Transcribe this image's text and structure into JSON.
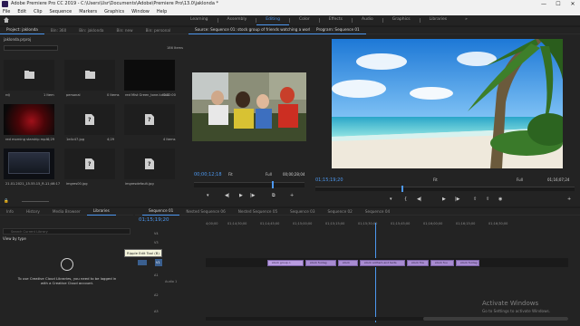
{
  "titlebar": {
    "title": "Adobe Premiere Pro CC 2019 - C:\\Users\\Usr\\Documents\\Adobe\\Premiere Pro\\13.0\\jaklonda *",
    "minimize": "—",
    "maximize": "☐",
    "close": "✕"
  },
  "menu": [
    "File",
    "Edit",
    "Clip",
    "Sequence",
    "Markers",
    "Graphics",
    "Window",
    "Help"
  ],
  "workspaces": {
    "tabs": [
      "Learning",
      "Assembly",
      "Editing",
      "Color",
      "Effects",
      "Audio",
      "Graphics",
      "Libraries"
    ],
    "active": "Editing",
    "more": "»"
  },
  "project": {
    "tabs": [
      "Project: jaklonda",
      "Bin: 360",
      "Bin: jaklonda",
      "Bin: new",
      "Bin: personal"
    ],
    "file": "jaklonda.prproj",
    "item_count": "186 Items",
    "items": [
      {
        "label": "rdj",
        "meta": "1 Item",
        "kind": "folder"
      },
      {
        "label": "personal",
        "meta": "",
        "kind": "folder"
      },
      {
        "label": "",
        "meta": "0 Items",
        "kind": "folder"
      },
      {
        "label": "red Mist Green_tone.lutOct",
        "meta": "1:22:00",
        "kind": "thumb-dark"
      },
      {
        "label": "red morning starship mp4",
        "meta": "4;29",
        "kind": "thumb-red"
      },
      {
        "label": "1e4c47.jpg",
        "meta": "4;29",
        "kind": "file"
      },
      {
        "label": "",
        "meta": "",
        "kind": "file"
      },
      {
        "label": "",
        "meta": "4 Items",
        "kind": "file"
      },
      {
        "label": "21.01.2021_15.55.15_R...",
        "meta": "11;46:17",
        "kind": "thumb-screen"
      },
      {
        "label": "imgres00.jpg",
        "meta": "4;29",
        "kind": "file"
      },
      {
        "label": "imgresdefault (1).jpg",
        "meta": "4;29",
        "kind": "file"
      },
      {
        "label": "imgresdefault.jpg",
        "meta": "4;29",
        "kind": "file"
      }
    ]
  },
  "source": {
    "tab": "Source: Sequence 01: stock group of friends watching a world cup m",
    "timecode": "00;00;12;18",
    "fit": "Fit",
    "quality": "Full",
    "duration": "00;00;28;04"
  },
  "program": {
    "tab": "Program: Sequence 01",
    "timecode": "01;15;19;20",
    "fit": "Fit",
    "quality": "Full",
    "duration": "01;16;07;24"
  },
  "libraries": {
    "tabs": [
      "Info",
      "History",
      "Media Browser",
      "Libraries"
    ],
    "view_by": "View by type",
    "search_placeholder": "Search Current Library",
    "message": "To use Creative Cloud Libraries, you need to be logged in with a Creative Cloud account."
  },
  "tooltip": "Ripple Edit Tool (B)",
  "timeline": {
    "tabs": [
      "Sequence 01",
      "Nested Sequence 06",
      "Nested Sequence 05",
      "Sequence 03",
      "Sequence 02",
      "Sequence 04"
    ],
    "timecode": "01;15;19;20",
    "ruler": [
      "4;00;00",
      "01;14;30;00",
      "01;14;45;00",
      "01;15;00;00",
      "01;15;15;00",
      "01;15;30;00",
      "01;15;45;00",
      "01;16;00;00",
      "01;16;15;00",
      "01;16;30;00"
    ],
    "video_tracks": [
      "V4",
      "V3",
      "V2",
      "V1"
    ],
    "audio_tracks": [
      "A1",
      "A2",
      "A3"
    ],
    "audio_labels": [
      "Audio 1",
      "",
      ""
    ],
    "clips": [
      "stock group o",
      "stock footag",
      "stock",
      "stock anthem and texts",
      "stock frie",
      "stock fou",
      "stock footag"
    ]
  },
  "watermark": {
    "line1": "Activate Windows",
    "line2": "Go to Settings to activate Windows."
  },
  "colors": {
    "accent": "#4d98f0",
    "clip": "#a88bd1"
  }
}
